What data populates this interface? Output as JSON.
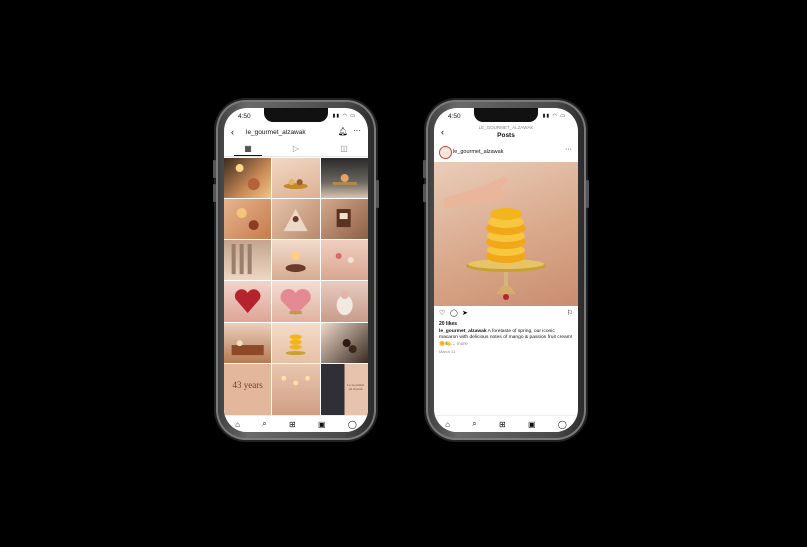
{
  "left_phone": {
    "status_time": "4:50",
    "username": "le_gourmet_alzawak",
    "tabs": [
      {
        "icon": "grid-icon",
        "glyph": "▦"
      },
      {
        "icon": "reels-icon",
        "glyph": "▷"
      },
      {
        "icon": "tagged-icon",
        "glyph": "◫"
      }
    ],
    "tile_texts": {
      "years_badge": "43 years",
      "invitation": "Le Gourmet Al Zawak"
    }
  },
  "right_phone": {
    "status_time": "4:50",
    "header_username": "LE_GOURMET_ALZAWAK",
    "header_title": "Posts",
    "post_username": "le_gourmet_alzawak",
    "likes": "20 likes",
    "caption_user": "le_gourmet_alzawak",
    "caption_text": " A foretaste of spring, our iconic macaron with delicious notes of mango & passion fruit cream! 🌼🍋...",
    "caption_more": "more",
    "date": "March 11"
  },
  "nav_icons": [
    "home-icon",
    "search-icon",
    "add-icon",
    "shop-icon",
    "profile-icon"
  ],
  "colors": {
    "phone_frame": "#4a4a4a",
    "brand_peach": "#e4b89f",
    "macaron_yellow": "#f2b51c",
    "gold_plate": "#c9a034"
  }
}
